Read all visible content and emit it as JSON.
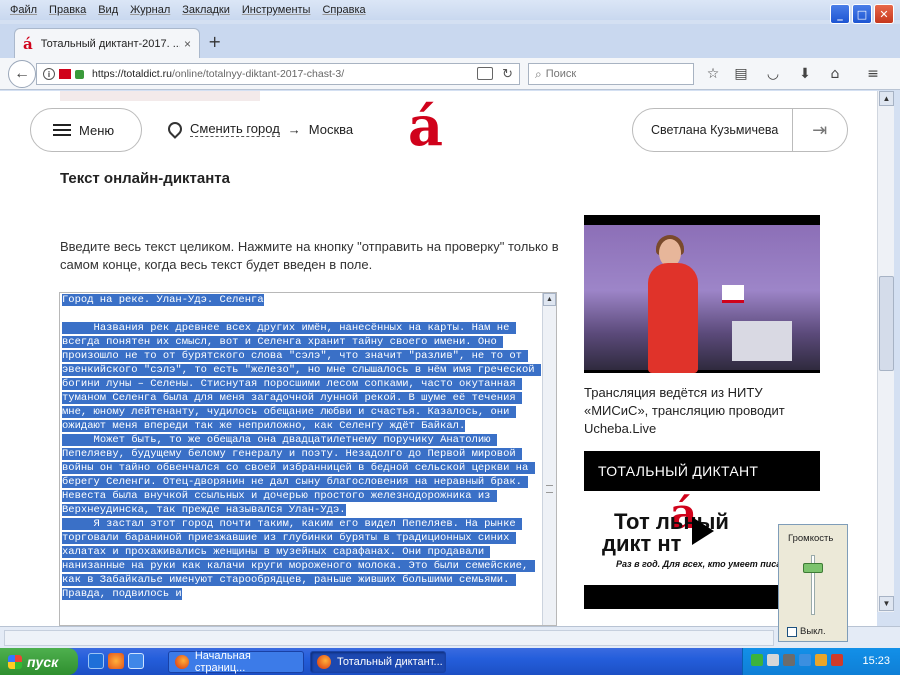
{
  "browser": {
    "menu": [
      "Файл",
      "Правка",
      "Вид",
      "Журнал",
      "Закладки",
      "Инструменты",
      "Справка"
    ],
    "window_controls": {
      "minimize": "_",
      "maximize": "□",
      "close": "✕"
    },
    "tab": {
      "title": "Тотальный диктант-2017. ...",
      "close": "×"
    },
    "new_tab": "+",
    "url": {
      "host": "https://totaldict.ru",
      "path": "/online/totalnyy-diktant-2017-chast-3/"
    },
    "search": {
      "placeholder": "Поиск"
    }
  },
  "site": {
    "menu_label": "Меню",
    "change_city": "Сменить город",
    "arrow": "→",
    "city": "Москва",
    "logo": "á",
    "user_name": "Светлана Кузьмичева",
    "exit_icon": "⇥",
    "heading": "Текст онлайн-диктанта",
    "instructions": "Введите весь текст целиком. Нажмите на кнопку \"отправить на проверку\" только в самом конце, когда весь текст будет введен в поле.",
    "editor_text": {
      "title_line": "Город на реке. Улан-Удэ. Селенга",
      "p1": "     Названия рек древнее всех других имён, нанесённых на карты. Нам не всегда понятен их смысл, вот и Селенга хранит тайну своего имени. Оно произошло не то от бурятского слова \"сэлэ\", что значит \"разлив\", не то от эвенкийского \"сэлэ\", то есть \"железо\", но мне слышалось в нём имя греческой богини луны – Селены. Стиснутая поросшими лесом сопками, часто окутанная туманом Селенга была для меня загадочной лунной рекой. В шуме её течения мне, юному лейтенанту, чудилось обещание любви и счастья. Казалось, они ожидают меня впереди так же неприложно, как Селенгу ждёт Байкал.",
      "p2": "     Может быть, то же обещала она двадцатилетнему поручику Анатолию Пепеляеву, будущему белому генералу и поэту. Незадолго до Первой мировой войны он тайно обвенчался со своей избранницей в бедной сельской церкви на берегу Селенги. Отец-дворянин не дал сыну благословения на неравный брак. Невеста была внучкой ссыльных и дочерью простого железнодорожника из Верхнеудинска, так прежде назывался Улан-Удэ.",
      "p3": "     Я застал этот город почти таким, каким его видел Пепеляев. На рынке торговали бараниной приезжавшие из глубинки буряты в традиционных синих халатах и прохаживались женщины в музейных сарафанах. Они продавали нанизанные на руки как калачи круги мороженого молока. Это были семейские, как в Забайкалье именуют старообрядцев, раньше живших большими семьями. Правда, подвилось и"
    },
    "video_caption": "Трансляция ведётся из НИТУ «МИСиС», трансляцию проводит Ucheba.Live",
    "promo": {
      "title": "ТОТАЛЬНЫЙ ДИКТАНТ",
      "brand_line1": "Тот  льный",
      "brand_line2": "дикт  нт",
      "brand_letter": "á",
      "slogan": "Раз в год. Для всех, кто умеет писа"
    }
  },
  "volume_popup": {
    "title": "Громкость",
    "mute": "Выкл."
  },
  "taskbar": {
    "start": "пуск",
    "items": [
      "Начальная страниц...",
      "Тотальный диктант..."
    ],
    "clock": "15:23"
  },
  "colors": {
    "accent": "#d0021b",
    "selection": "#3a70c7",
    "taskbar": "#245edb"
  }
}
